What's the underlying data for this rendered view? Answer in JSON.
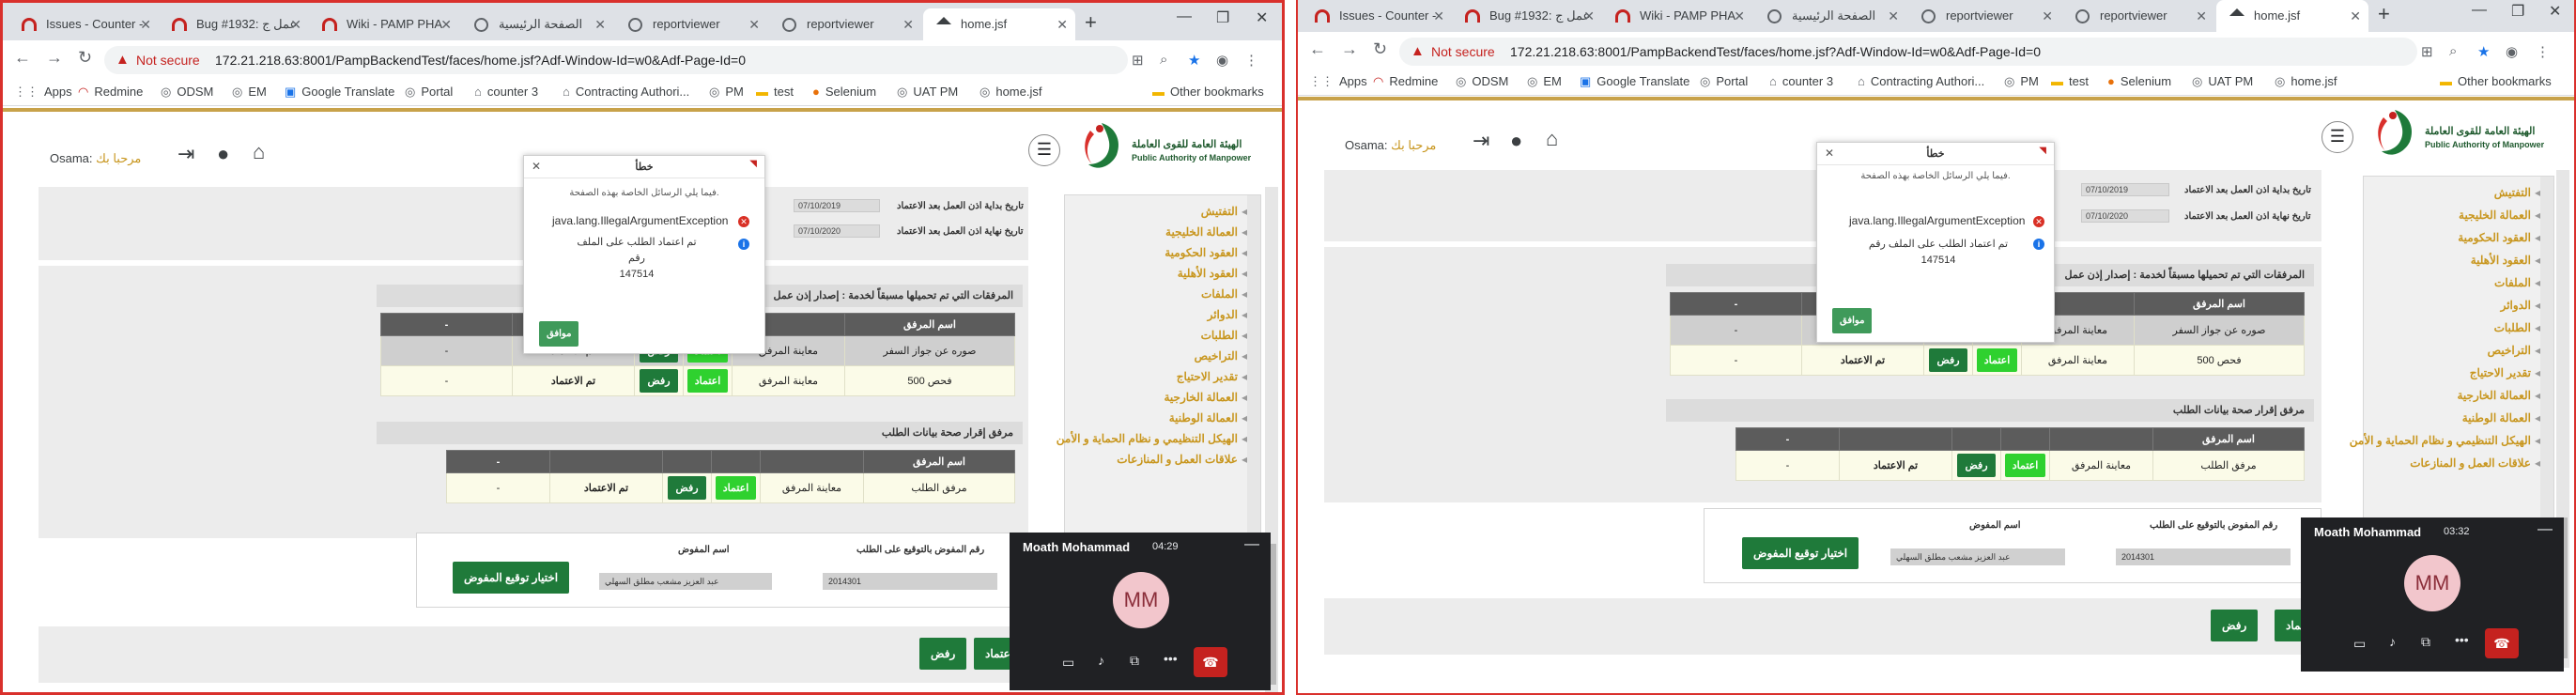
{
  "browser": {
    "tabs": [
      {
        "title": "Issues - Counter -",
        "icon": "redmine-icon"
      },
      {
        "title": "Bug #1932: عمل ج",
        "icon": "redmine-icon"
      },
      {
        "title": "Wiki - PAMP PHA",
        "icon": "redmine-icon"
      },
      {
        "title": "الصفحة الرئيسية",
        "icon": "globe-icon"
      },
      {
        "title": "reportviewer",
        "icon": "globe-icon"
      },
      {
        "title": "reportviewer",
        "icon": "globe-icon"
      },
      {
        "title": "home.jsf",
        "icon": "home-icon"
      }
    ],
    "url_warning": "Not secure",
    "url": "172.21.218.63:8001/PampBackendTest/faces/home.jsf?Adf-Window-Id=w0&Adf-Page-Id=0",
    "bookmarks": [
      "Apps",
      "Redmine",
      "ODSM",
      "EM",
      "Google Translate",
      "Portal",
      "counter 3",
      "Contracting Authori...",
      "PM",
      "test",
      "Selenium",
      "UAT PM",
      "home.jsf"
    ],
    "other_bookmarks": "Other bookmarks"
  },
  "header": {
    "greeting": "مرحبا بك",
    "username": "Osama:",
    "org_name_ar": "الهيئة العامة للقوى العاملة",
    "org_name_en": "Public Authority of Manpower"
  },
  "sidebar": {
    "items": [
      "التفتيش",
      "العمالة الخليجية",
      "العقود الحكومية",
      "العقود الأهلية",
      "الملفات",
      "الدوائر",
      "الطلبات",
      "التراخيص",
      "تقدير الاحتياج",
      "العمالة الخارجية",
      "العمالة الوطنية",
      "الهيكل التنظيمي و نظام الحماية و الأمن",
      "علاقات العمل و المنازعات"
    ]
  },
  "form": {
    "start_label": "تاريخ بداية اذن العمل بعد الاعتماد",
    "start_value": "07/10/2019",
    "end_label": "تاريخ نهاية اذن العمل بعد الاعتماد",
    "end_value": "07/10/2020"
  },
  "attachments_section": {
    "title": "المرفقات التي تم تحميلها مسبقاً لخدمة : إصدار إذن عمل",
    "col_name": "اسم المرفق",
    "dash": "-",
    "rows": [
      {
        "name": "صوره عن جواز السفر",
        "view": "معاينة المرفق",
        "approve": "اعتماد",
        "reject": "رفض",
        "status": "تم الاعتماد",
        "extra": "-"
      },
      {
        "name": "فحص 500",
        "view": "معاينة المرفق",
        "approve": "اعتماد",
        "reject": "رفض",
        "status": "تم الاعتماد",
        "extra": "-"
      }
    ]
  },
  "validity_section": {
    "title": "مرفق إقرار صحة بيانات الطلب",
    "col_name": "اسم المرفق",
    "dash": "-",
    "rows": [
      {
        "name": "مرفق الطلب",
        "view": "معاينة المرفق",
        "approve": "اعتماد",
        "reject": "رفض",
        "status": "تم الاعتماد",
        "extra": "-"
      }
    ]
  },
  "signature": {
    "number_label": "رقم المفوض بالتوقيع على الطلب",
    "number_value": "2014301",
    "name_label": "اسم المفوض",
    "name_value": "عبد العزيز مشعب مطلق السهلي",
    "choose_button": "اختيار توقيع المفوض"
  },
  "footer_buttons": {
    "approve": "اعتماد",
    "reject": "رفض"
  },
  "dialog": {
    "title": "خطأ",
    "intro": "فيما يلي الرسائل الخاصة بهذه الصفحة.",
    "exception": "java.lang.IllegalArgumentException",
    "message_line1": "تم اعتماد الطلب على الملف رقم",
    "message_line2": "147514",
    "ok": "موافق"
  },
  "call": {
    "name": "Moath Mohammad",
    "initials": "MM",
    "time_left": "04:29",
    "time_right": "03:32"
  },
  "colors": {
    "accent_gold": "#c8961e",
    "green": "#1f7a3a",
    "lime": "#2fd12f",
    "header_gray": "#5c5c5c"
  }
}
